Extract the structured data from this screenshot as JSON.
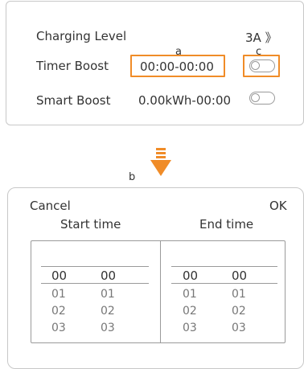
{
  "settings": {
    "charging_level_label": "Charging Level",
    "charging_level_value": "3A 》",
    "timer_boost_label": "Timer Boost",
    "timer_boost_value": "00:00-00:00",
    "smart_boost_label": "Smart Boost",
    "smart_boost_value": "0.00kWh-00:00",
    "timer_boost_enabled": false,
    "smart_boost_enabled": false
  },
  "callouts": {
    "a": "a",
    "b": "b",
    "c": "c"
  },
  "colors": {
    "highlight": "#f08c28",
    "border": "#c8c8c8"
  },
  "icons": {
    "arrow": "down-arrow-icon",
    "toggle": "toggle-switch-icon"
  },
  "dialog": {
    "cancel_label": "Cancel",
    "ok_label": "OK",
    "start_title": "Start time",
    "end_title": "End time",
    "start": {
      "hours": [
        "00",
        "01",
        "02",
        "03"
      ],
      "minutes": [
        "00",
        "01",
        "02",
        "03"
      ]
    },
    "end": {
      "hours": [
        "00",
        "01",
        "02",
        "03"
      ],
      "minutes": [
        "00",
        "01",
        "02",
        "03"
      ]
    }
  }
}
